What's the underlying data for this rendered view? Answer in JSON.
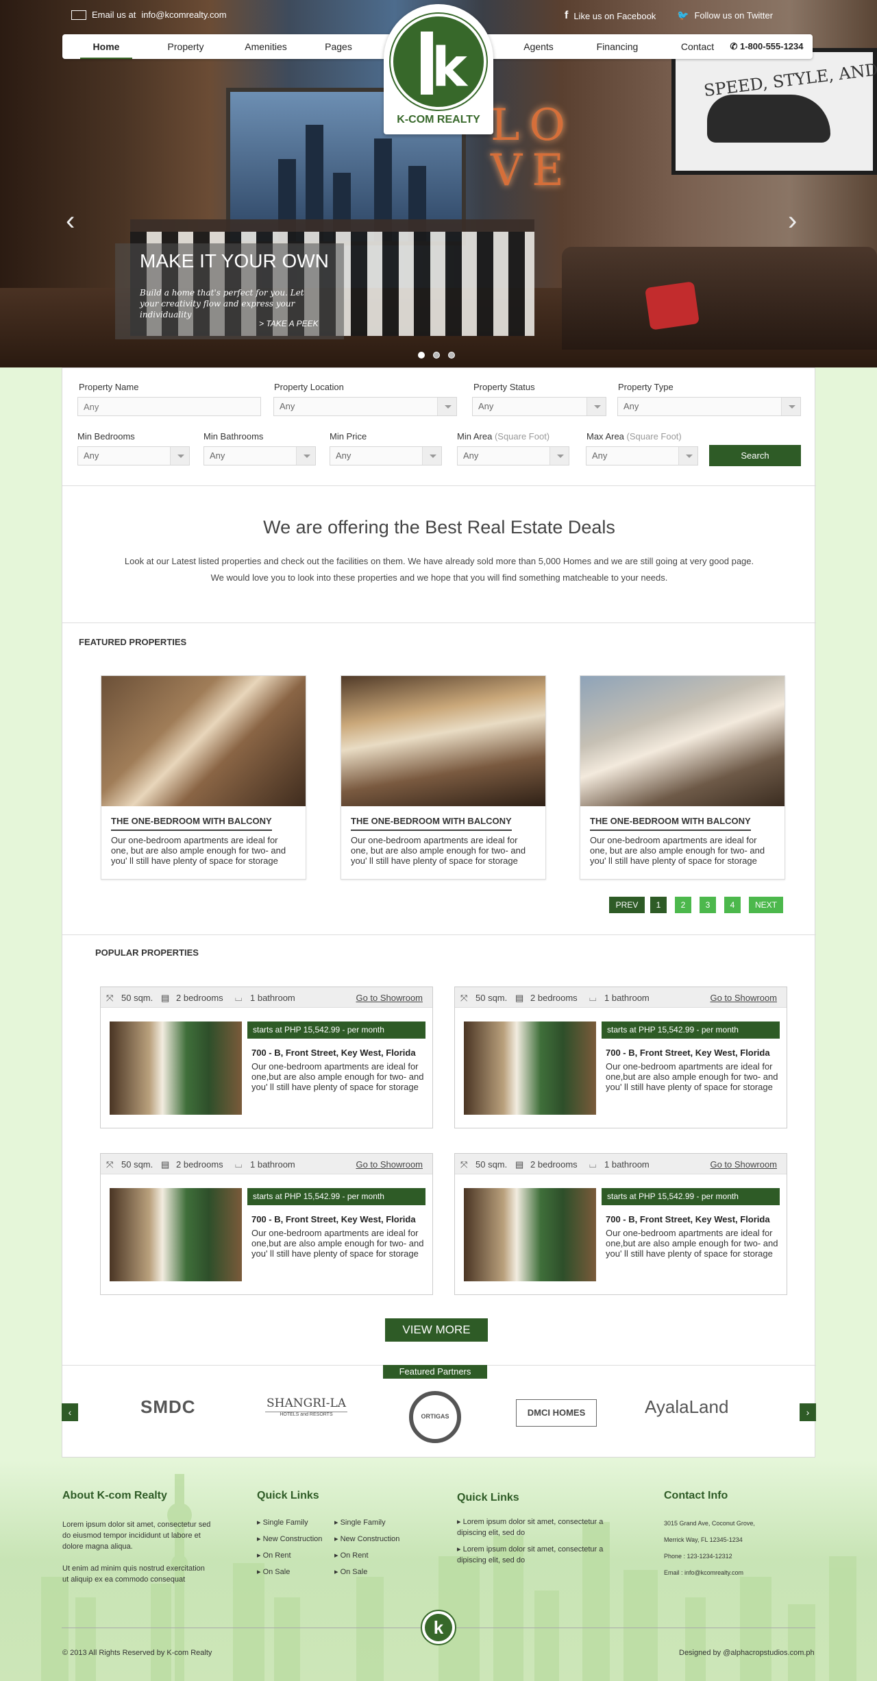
{
  "topbar": {
    "email_label": "Email us at",
    "email": "info@kcomrealty.com",
    "facebook": "Like us on Facebook",
    "twitter": "Follow us on Twitter"
  },
  "nav": {
    "items": [
      "Home",
      "Property",
      "Amenities",
      "Pages",
      "Agents",
      "Financing",
      "Contact"
    ],
    "phone": "1-800-555-1234"
  },
  "logo": {
    "name": "K-COM REALTY",
    "mark": "k"
  },
  "hero": {
    "title": "MAKE IT YOUR OWN",
    "text": "Build a home that's perfect for you. Let your creativity flow and express your individuality",
    "link": "> TAKE A PEEK",
    "frame_text": "SPEED, STYLE, AND BEAUTY",
    "sign": "LO VE"
  },
  "search": {
    "property_name": {
      "label": "Property Name",
      "placeholder": "Any"
    },
    "property_location": {
      "label": "Property Location",
      "value": "Any"
    },
    "property_status": {
      "label": "Property Status",
      "value": "Any"
    },
    "property_type": {
      "label": "Property Type",
      "value": "Any"
    },
    "min_bedrooms": {
      "label": "Min Bedrooms",
      "value": "Any"
    },
    "min_bathrooms": {
      "label": "Min Bathrooms",
      "value": "Any"
    },
    "min_price": {
      "label": "Min Price",
      "value": "Any"
    },
    "min_area": {
      "label": "Min Area",
      "unit": "(Square Foot)",
      "value": "Any"
    },
    "max_area": {
      "label": "Max Area",
      "unit": "(Square Foot)",
      "value": "Any"
    },
    "button": "Search"
  },
  "intro": {
    "title": "We are offering the Best Real Estate Deals",
    "line1": "Look at our Latest listed properties and check out the facilities on them. We have already sold more than 5,000 Homes and we are still going at very good page.",
    "line2": "We would love you to look into these properties and we hope that you will find something matcheable to your needs."
  },
  "featured": {
    "heading": "FEATURED PROPERTIES",
    "cards": [
      {
        "title": "THE ONE-BEDROOM WITH BALCONY",
        "text": "Our one-bedroom apartments are ideal for one, but are also ample enough for two- and you' ll still have plenty of space for storage"
      },
      {
        "title": "THE ONE-BEDROOM WITH BALCONY",
        "text": "Our one-bedroom apartments are ideal for one, but are also ample enough for two- and you' ll still have plenty of space for storage"
      },
      {
        "title": "THE ONE-BEDROOM WITH BALCONY",
        "text": "Our one-bedroom apartments are ideal for one, but are also ample enough for two- and you' ll still have plenty of space for storage"
      }
    ],
    "pager": {
      "prev": "PREV",
      "pages": [
        "1",
        "2",
        "3",
        "4"
      ],
      "next": "NEXT"
    }
  },
  "popular": {
    "heading": "POPULAR PROPERTIES",
    "items": [
      {
        "area": "50 sqm.",
        "beds": "2 bedrooms",
        "baths": "1 bathroom",
        "link": "Go to Showroom",
        "price": "starts at PHP 15,542.99 - per month",
        "address": "700 - B, Front Street, Key West, Florida",
        "text": "Our one-bedroom apartments are ideal for one,but are also ample enough for two- and you' ll still have plenty of space for storage"
      },
      {
        "area": "50 sqm.",
        "beds": "2 bedrooms",
        "baths": "1 bathroom",
        "link": "Go to Showroom",
        "price": "starts at PHP 15,542.99 - per month",
        "address": "700 - B, Front Street, Key West, Florida",
        "text": "Our one-bedroom apartments are ideal for one,but are also ample enough for two- and you' ll still have plenty of space for storage"
      },
      {
        "area": "50 sqm.",
        "beds": "2 bedrooms",
        "baths": "1 bathroom",
        "link": "Go to Showroom",
        "price": "starts at PHP 15,542.99 - per month",
        "address": "700 - B, Front Street, Key West, Florida",
        "text": "Our one-bedroom apartments are ideal for one,but are also ample enough for two- and you' ll still have plenty of space for storage"
      },
      {
        "area": "50 sqm.",
        "beds": "2 bedrooms",
        "baths": "1 bathroom",
        "link": "Go to Showroom",
        "price": "starts at PHP 15,542.99 - per month",
        "address": "700 - B, Front Street, Key West, Florida",
        "text": "Our one-bedroom apartments are ideal for one,but are also ample enough for two- and you' ll still have plenty of space for storage"
      }
    ],
    "view_more": "VIEW MORE"
  },
  "partners": {
    "heading": "Featured Partners",
    "items": [
      "SMDC",
      "SHANGRI-LA",
      "HOTELS and RESORTS",
      "ORTIGAS",
      "DMCI HOMES",
      "AyalaLand"
    ]
  },
  "footer": {
    "about": {
      "title": "About K-com Realty",
      "p1": "Lorem ipsum dolor sit amet, consectetur sed do eiusmod tempor incididunt ut labore et dolore magna aliqua.",
      "p2": "Ut enim ad minim quis nostrud exercitation ut aliquip ex ea commodo consequat"
    },
    "quick1": {
      "title": "Quick Links",
      "col1": [
        "Single Family",
        "New Construction",
        "On Rent",
        "On Sale"
      ],
      "col2": [
        "Single Family",
        "New Construction",
        "On Rent",
        "On Sale"
      ]
    },
    "quick2": {
      "title": "Quick Links",
      "items": [
        "Lorem ipsum dolor sit amet, consectetur a dipiscing elit, sed do",
        "Lorem ipsum dolor sit amet, consectetur a dipiscing elit, sed do"
      ]
    },
    "contact": {
      "title": "Contact Info",
      "addr1": "3015 Grand Ave, Coconut Grove,",
      "addr2": "Merrick Way, FL 12345-1234",
      "phone": "Phone :  123-1234-12312",
      "email": "Email : info@kcomrealty.com"
    },
    "copyright": "© 2013 All Rights Reserved by K-com Realty",
    "designed": "Designed by @alphacropstudios.com.ph"
  },
  "colors": {
    "brand_green": "#2e5b26",
    "pager_green": "#4cb84c",
    "page_bg": "#e5f6d9"
  }
}
